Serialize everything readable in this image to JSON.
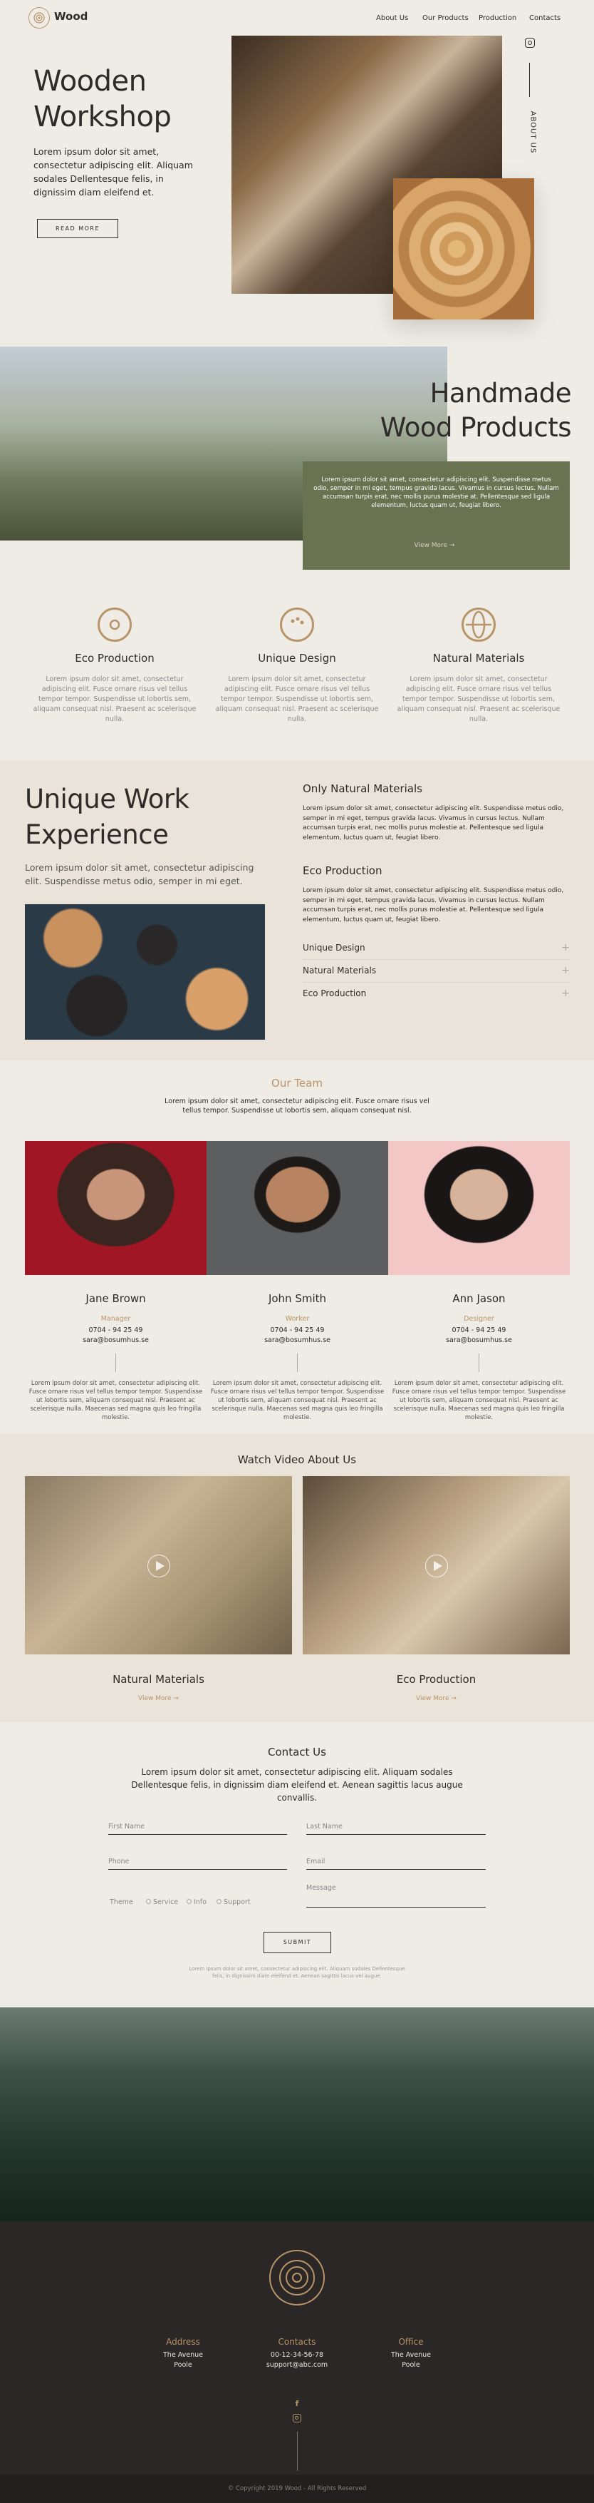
{
  "header": {
    "logo_text": "Wood",
    "nav": [
      "About Us",
      "Our Products",
      "Production",
      "Contacts"
    ]
  },
  "hero": {
    "title_line1": "Wooden",
    "title_line2": "Workshop",
    "text": "Lorem ipsum dolor sit amet, consectetur adipiscing elit. Aliquam sodales Dellentesque felis, in dignissim diam eleifend et.",
    "button": "READ MORE",
    "side_label": "ABOUT US"
  },
  "handmade": {
    "title_line1": "Handmade",
    "title_line2": "Wood Products",
    "text": "Lorem ipsum dolor sit amet, consectetur adipiscing elit. Suspendisse metus odio, semper in mi eget, tempus gravida lacus. Vivamus in cursus lectus. Nullam accumsan turpis erat, nec mollis purus molestie at. Pellentesque sed ligula elementum, luctus quam ut, feugiat libero.",
    "link": "View More"
  },
  "features": [
    {
      "title": "Eco Production",
      "text": "Lorem ipsum dolor sit amet, consectetur adipiscing elit. Fusce ornare risus vel tellus tempor tempor. Suspendisse ut lobortis sem, aliquam consequat nisl. Praesent ac scelerisque nulla."
    },
    {
      "title": "Unique Design",
      "text": "Lorem ipsum dolor sit amet, consectetur adipiscing elit. Fusce ornare risus vel tellus tempor tempor. Suspendisse ut lobortis sem, aliquam consequat nisl. Praesent ac scelerisque nulla."
    },
    {
      "title": "Natural Materials",
      "text": "Lorem ipsum dolor sit amet, consectetur adipiscing elit. Fusce ornare risus vel tellus tempor tempor. Suspendisse ut lobortis sem, aliquam consequat nisl. Praesent ac scelerisque nulla."
    }
  ],
  "experience": {
    "title_line1": "Unique Work",
    "title_line2": "Experience",
    "text": "Lorem ipsum dolor sit amet, consectetur adipiscing elit. Suspendisse metus odio, semper in mi eget.",
    "block1_title": "Only Natural Materials",
    "block1_text": "Lorem ipsum dolor sit amet, consectetur adipiscing elit. Suspendisse metus odio, semper in mi eget, tempus gravida lacus. Vivamus in cursus lectus. Nullam accumsan turpis erat, nec mollis purus molestie at. Pellentesque sed ligula elementum, luctus quam ut, feugiat libero.",
    "block2_title": "Eco Production",
    "block2_text": "Lorem ipsum dolor sit amet, consectetur adipiscing elit. Suspendisse metus odio, semper in mi eget, tempus gravida lacus. Vivamus in cursus lectus. Nullam accumsan turpis erat, nec mollis purus molestie at. Pellentesque sed ligula elementum, luctus quam ut, feugiat libero.",
    "accordion": [
      "Unique Design",
      "Natural Materials",
      "Eco Production"
    ]
  },
  "team": {
    "title": "Our Team",
    "text": "Lorem ipsum dolor sit amet, consectetur adipiscing elit. Fusce ornare risus vel tellus tempor. Suspendisse ut lobortis sem, aliquam consequat nisl.",
    "members": [
      {
        "name": "Jane Brown",
        "role": "Manager",
        "phone": "0704 - 94 25 49",
        "email": "sara@bosumhus.se",
        "bio": "Lorem ipsum dolor sit amet, consectetur adipiscing elit. Fusce ornare risus vel tellus tempor tempor. Suspendisse ut lobortis sem, aliquam consequat nisl. Praesent ac scelerisque nulla. Maecenas sed magna quis leo fringilla molestie."
      },
      {
        "name": "John Smith",
        "role": "Worker",
        "phone": "0704 - 94 25 49",
        "email": "sara@bosumhus.se",
        "bio": "Lorem ipsum dolor sit amet, consectetur adipiscing elit. Fusce ornare risus vel tellus tempor tempor. Suspendisse ut lobortis sem, aliquam consequat nisl. Praesent ac scelerisque nulla. Maecenas sed magna quis leo fringilla molestie."
      },
      {
        "name": "Ann Jason",
        "role": "Designer",
        "phone": "0704 - 94 25 49",
        "email": "sara@bosumhus.se",
        "bio": "Lorem ipsum dolor sit amet, consectetur adipiscing elit. Fusce ornare risus vel tellus tempor tempor. Suspendisse ut lobortis sem, aliquam consequat nisl. Praesent ac scelerisque nulla. Maecenas sed magna quis leo fringilla molestie."
      }
    ]
  },
  "video": {
    "title": "Watch Video About Us",
    "items": [
      {
        "title": "Natural Materials",
        "link": "View More"
      },
      {
        "title": "Eco Production",
        "link": "View More"
      }
    ]
  },
  "contact": {
    "title": "Contact Us",
    "text": "Lorem ipsum dolor sit amet, consectetur adipiscing elit. Aliquam sodales Dellentesque felis, in dignissim diam eleifend et. Aenean sagittis lacus augue convallis.",
    "first_name": "First Name",
    "last_name": "Last Name",
    "phone": "Phone",
    "email": "Email",
    "theme_label": "Theme",
    "message": "Message",
    "themes": [
      "Service",
      "Info",
      "Support"
    ],
    "submit": "SUBMIT",
    "note": "Lorem ipsum dolor sit amet, consectetur adipiscing elit. Aliquam sodales Dellentesque felis, in dignissim diam eleifend et. Aenean sagittis lacus vel augue."
  },
  "footer": {
    "address_title": "Address",
    "address_lines": [
      "The Avenue",
      "Poole"
    ],
    "contacts_title": "Contacts",
    "contacts_lines": [
      "00-12-34-56-78",
      "support@abc.com"
    ],
    "office_title": "Office",
    "office_lines": [
      "The Avenue",
      "Poole"
    ],
    "copyright": "© Copyright 2019 Wood - All Rights Reserved"
  },
  "colors": {
    "accent": "#b8946a",
    "green": "#6a7351",
    "dark": "#2b2726"
  }
}
